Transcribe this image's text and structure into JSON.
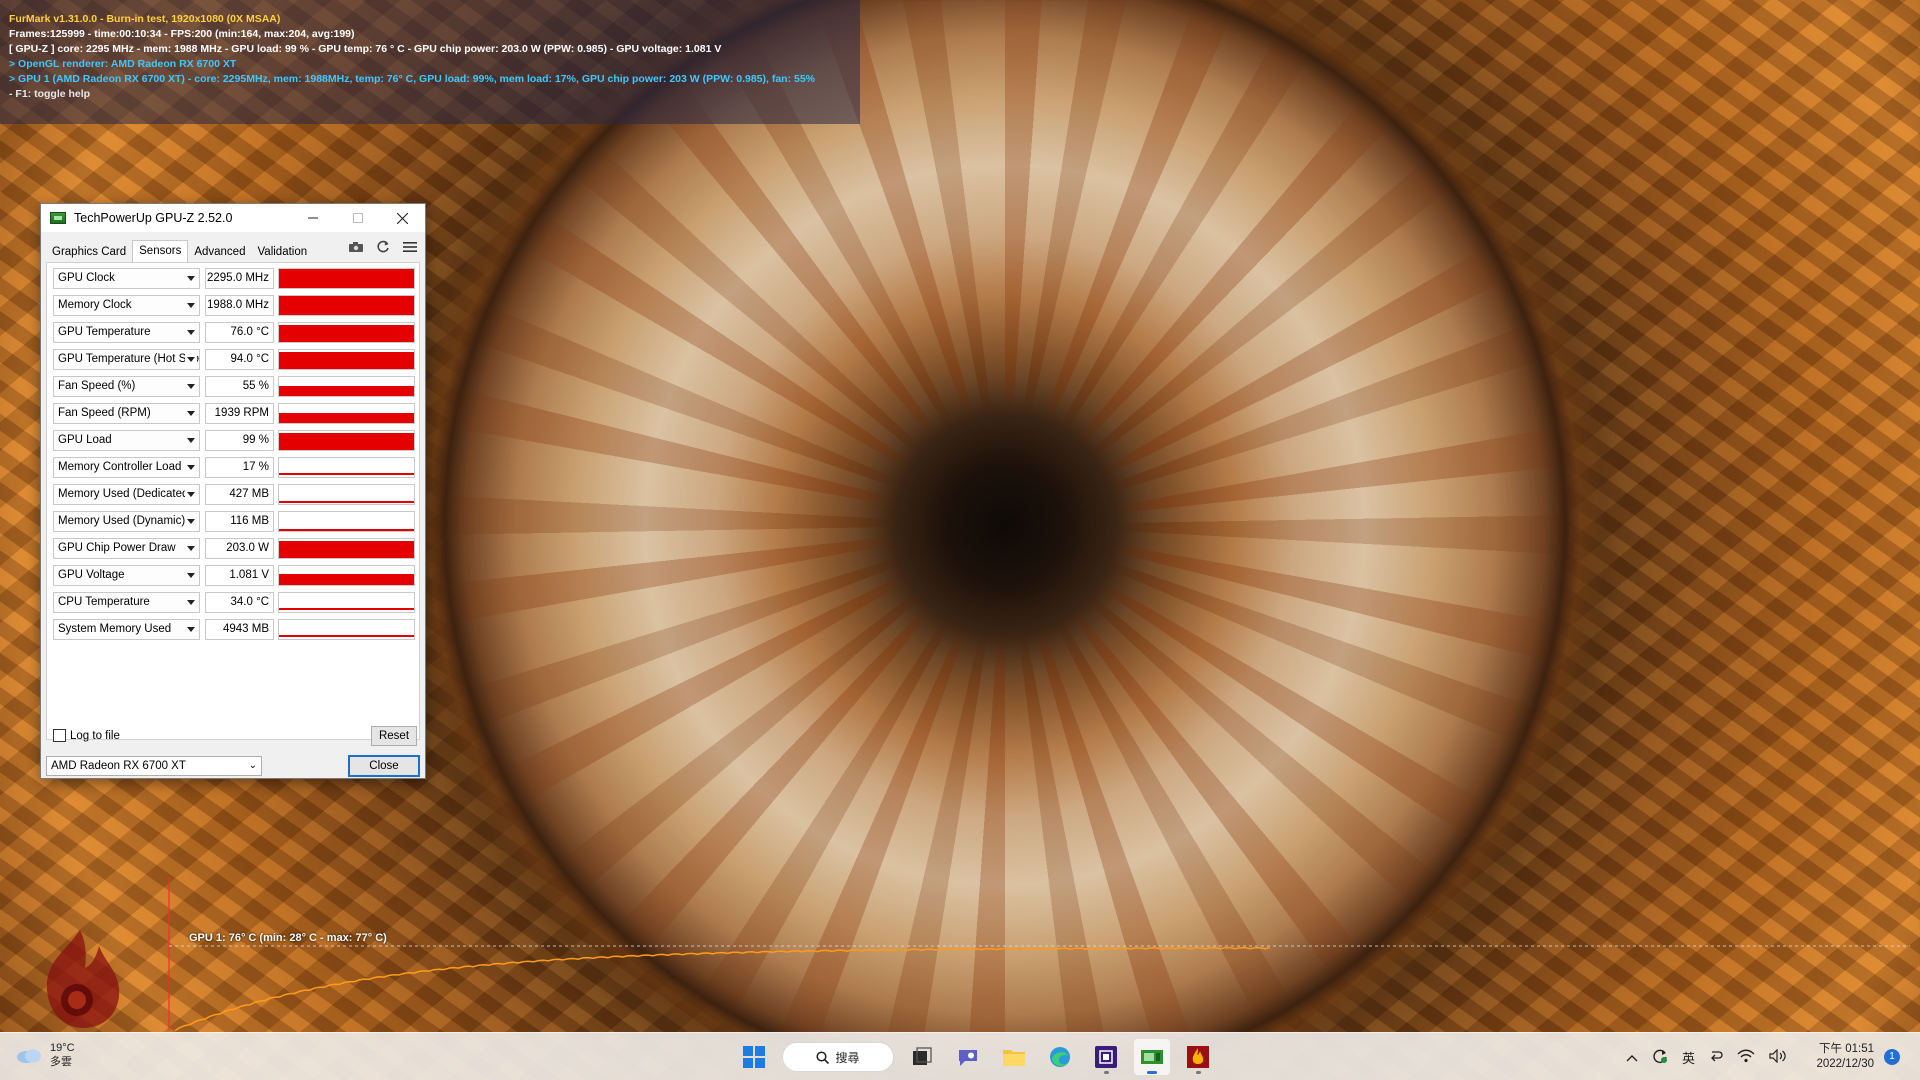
{
  "overlay": {
    "line1": "FurMark v1.31.0.0 - Burn-in test, 1920x1080 (0X MSAA)",
    "line2": "Frames:125999 - time:00:10:34 - FPS:200 (min:164, max:204, avg:199)",
    "line3": "[ GPU-Z ] core: 2295 MHz - mem: 1988 MHz - GPU load: 99 % - GPU temp: 76 ° C - GPU chip power: 203.0 W (PPW: 0.985) - GPU voltage: 1.081 V",
    "line4": "> OpenGL renderer: AMD Radeon RX 6700 XT",
    "line5": "> GPU 1 (AMD Radeon RX 6700 XT) - core: 2295MHz, mem: 1988MHz, temp: 76° C, GPU load: 99%, mem load: 17%, GPU chip power: 203 W (PPW: 0.985), fan: 55%",
    "line6": "- F1: toggle help"
  },
  "gpuz": {
    "title": "TechPowerUp GPU-Z 2.52.0",
    "tabs": [
      "Graphics Card",
      "Sensors",
      "Advanced",
      "Validation"
    ],
    "active_tab": "Sensors",
    "sensors": [
      {
        "name": "GPU Clock",
        "value": "2295.0 MHz",
        "level": 0.98,
        "style": "full"
      },
      {
        "name": "Memory Clock",
        "value": "1988.0 MHz",
        "level": 0.98,
        "style": "full"
      },
      {
        "name": "GPU Temperature",
        "value": "76.0 °C",
        "level": 0.9,
        "style": "full"
      },
      {
        "name": "GPU Temperature (Hot Spot)",
        "value": "94.0 °C",
        "level": 0.88,
        "style": "full"
      },
      {
        "name": "Fan Speed (%)",
        "value": "55 %",
        "level": 0.55,
        "style": "full"
      },
      {
        "name": "Fan Speed (RPM)",
        "value": "1939 RPM",
        "level": 0.55,
        "style": "full"
      },
      {
        "name": "GPU Load",
        "value": "99 %",
        "level": 0.92,
        "style": "full"
      },
      {
        "name": "Memory Controller Load",
        "value": "17 %",
        "level": 0.15,
        "style": "line"
      },
      {
        "name": "Memory Used (Dedicated)",
        "value": "427 MB",
        "level": 0.05,
        "style": "line"
      },
      {
        "name": "Memory Used (Dynamic)",
        "value": "116 MB",
        "level": 0.02,
        "style": "line"
      },
      {
        "name": "GPU Chip Power Draw",
        "value": "203.0 W",
        "level": 0.92,
        "style": "full"
      },
      {
        "name": "GPU Voltage",
        "value": "1.081 V",
        "level": 0.6,
        "style": "full"
      },
      {
        "name": "CPU Temperature",
        "value": "34.0 °C",
        "level": 0.12,
        "style": "line"
      },
      {
        "name": "System Memory Used",
        "value": "4943 MB",
        "level": 0.1,
        "style": "line"
      }
    ],
    "log_label": "Log to file",
    "reset_label": "Reset",
    "gpu_select": "AMD Radeon RX 6700 XT",
    "close_label": "Close",
    "accent": "#e50000"
  },
  "temp_graph": {
    "label": "GPU 1: 76° C (min: 28° C - max: 77° C)",
    "min": 28,
    "max": 77,
    "current": 76,
    "color": "#ff9a1a"
  },
  "taskbar": {
    "weather_temp": "19°C",
    "weather_desc": "多雲",
    "search_label": "搜尋",
    "apps": [
      "start-icon",
      "search",
      "task-view-icon",
      "chat-icon",
      "file-explorer-icon",
      "edge-icon",
      "cpu-z-icon",
      "gpu-z-icon",
      "furmark-icon"
    ],
    "ime": "英",
    "clock_time": "下午 01:51",
    "clock_date": "2022/12/30",
    "notifications": "1"
  }
}
